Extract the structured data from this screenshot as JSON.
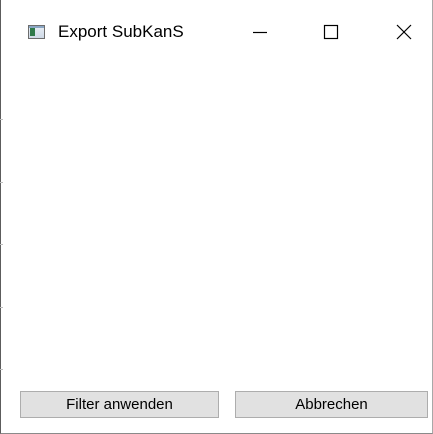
{
  "window": {
    "title": "Export SubKanS",
    "icon": "application-window-icon"
  },
  "titlebar": {
    "minimize_icon": "minimize-icon",
    "maximize_icon": "maximize-icon",
    "close_icon": "close-icon"
  },
  "footer": {
    "apply_filter_label": "Filter anwenden",
    "cancel_label": "Abbrechen"
  },
  "colors": {
    "button_face": "#e1e1e1",
    "button_border": "#adadad",
    "window_background": "#ffffff",
    "text": "#000000"
  }
}
